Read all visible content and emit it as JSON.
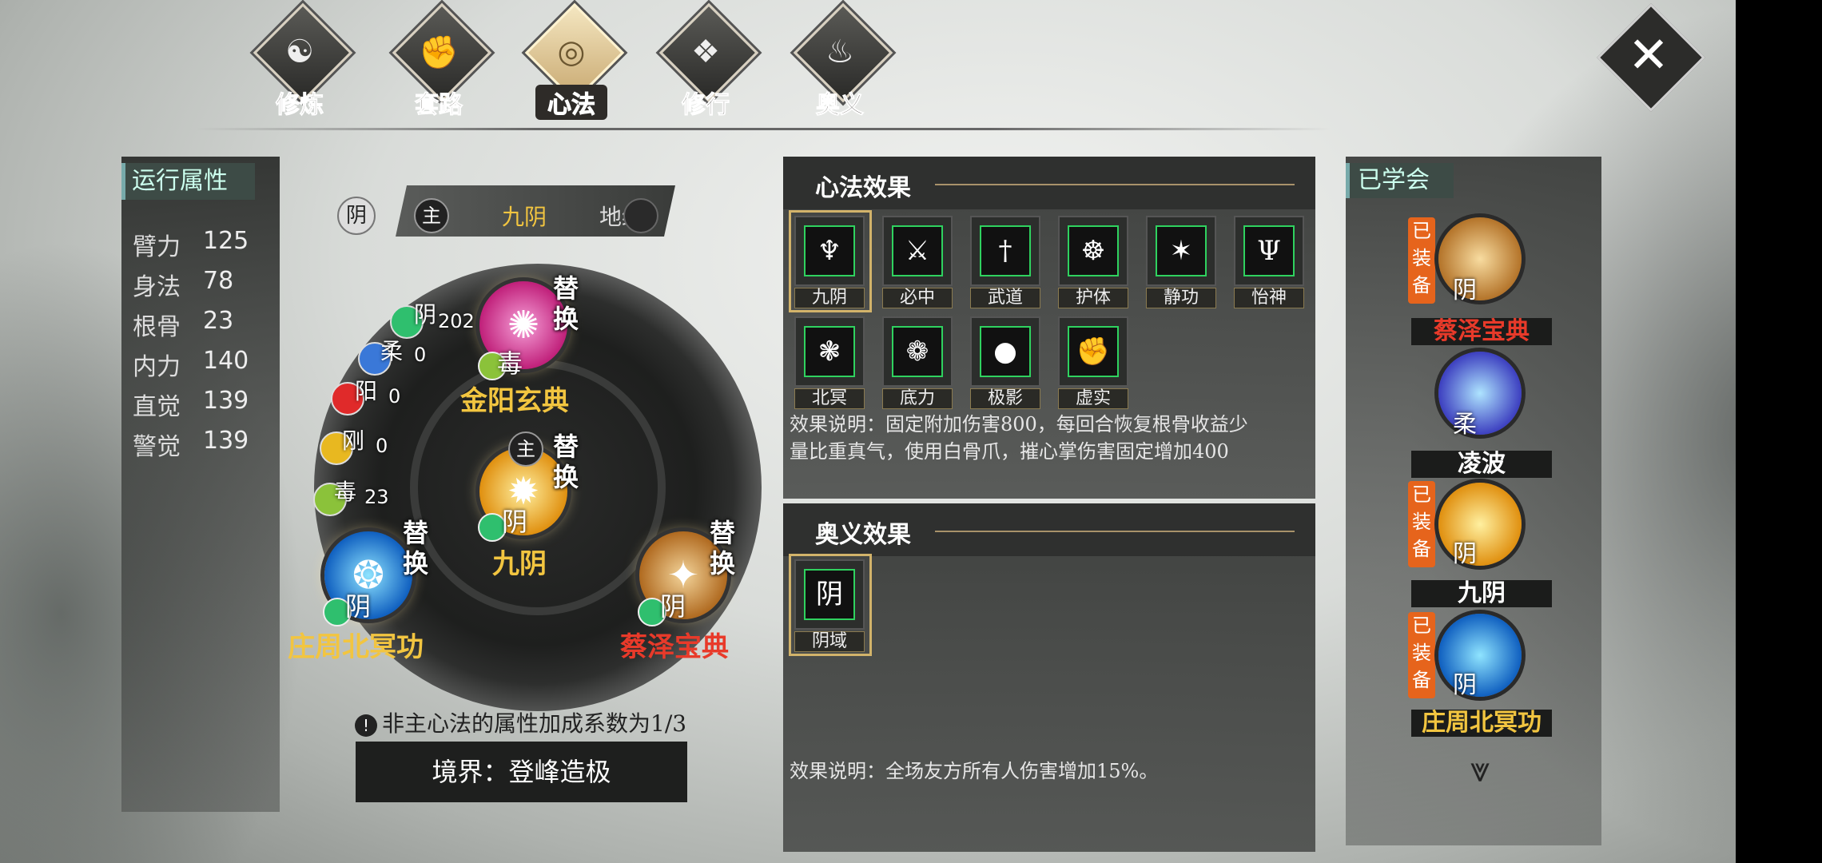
{
  "tabs": [
    {
      "label": "修炼",
      "icon": "ying-yang-icon",
      "active": false
    },
    {
      "label": "套路",
      "icon": "fist-icon",
      "active": false
    },
    {
      "label": "心法",
      "icon": "swirl-icon",
      "active": true
    },
    {
      "label": "修行",
      "icon": "scroll-icon",
      "active": false
    },
    {
      "label": "奥义",
      "icon": "flame-icon",
      "active": false
    }
  ],
  "close_glyph": "✕",
  "attributes": {
    "title": "运行属性",
    "items": [
      {
        "name": "臂力",
        "value": "125"
      },
      {
        "name": "身法",
        "value": "78"
      },
      {
        "name": "根骨",
        "value": "23"
      },
      {
        "name": "内力",
        "value": "140"
      },
      {
        "name": "直觉",
        "value": "139"
      },
      {
        "name": "警觉",
        "value": "139"
      }
    ]
  },
  "mode_selector": {
    "yin": "阴",
    "main": "主",
    "option1": "九阴",
    "option2": "地绝"
  },
  "wheel": {
    "top": {
      "name": "金阳玄典",
      "swap": "替换",
      "tag": "毒",
      "color": "#d12d8c"
    },
    "center": {
      "name": "九阴",
      "swap": "替换",
      "tag": "阴",
      "main": "主",
      "color": "#e8a818"
    },
    "left": {
      "name": "庄周北冥功",
      "swap": "替换",
      "tag": "阴",
      "color": "#1a7fd8"
    },
    "right": {
      "name": "蔡泽宝典",
      "swap": "替换",
      "tag": "阴",
      "color": "#c07a22"
    },
    "elements": [
      {
        "name": "阴",
        "value": "202",
        "color": "#2fbf6e"
      },
      {
        "name": "柔",
        "value": "0",
        "color": "#3a78d8"
      },
      {
        "name": "阳",
        "value": "0",
        "color": "#e02a2a"
      },
      {
        "name": "刚",
        "value": "0",
        "color": "#e8b820"
      },
      {
        "name": "毒",
        "value": "23",
        "color": "#8bc23a"
      }
    ]
  },
  "note": "非主心法的属性加成系数为1/3",
  "note_icon": "!",
  "realm": "境界：登峰造极",
  "xinfa_effects": {
    "title": "心法效果",
    "skills": [
      "九阴",
      "必中",
      "武道",
      "护体",
      "静功",
      "怡神",
      "北冥",
      "底力",
      "极影",
      "虚实"
    ],
    "description_line1": "效果说明：固定附加伤害800，每回合恢复根骨收益少",
    "description_line2": "量比重真气，使用白骨爪，摧心掌伤害固定增加400"
  },
  "aoyi_effects": {
    "title": "奥义效果",
    "skills": [
      "阴域"
    ],
    "icon_text": "阴",
    "description": "效果说明：全场友方所有人伤害增加15%。"
  },
  "learned": {
    "title": "已学会",
    "items": [
      {
        "name": "蔡泽宝典",
        "type": "阴",
        "equipped": "已装备",
        "name_color": "#e83a2a",
        "color": "#c88a30"
      },
      {
        "name": "凌波",
        "type": "柔",
        "equipped": "",
        "name_color": "#ffffff",
        "color": "#3d5fd0"
      },
      {
        "name": "九阴",
        "type": "阴",
        "equipped": "已装备",
        "name_color": "#ffffff",
        "color": "#e8a818"
      },
      {
        "name": "庄周北冥功",
        "type": "阴",
        "equipped": "已装备",
        "name_color": "#f2c540",
        "color": "#1a7fd8"
      }
    ]
  },
  "scroll_down_glyph": "⩔"
}
